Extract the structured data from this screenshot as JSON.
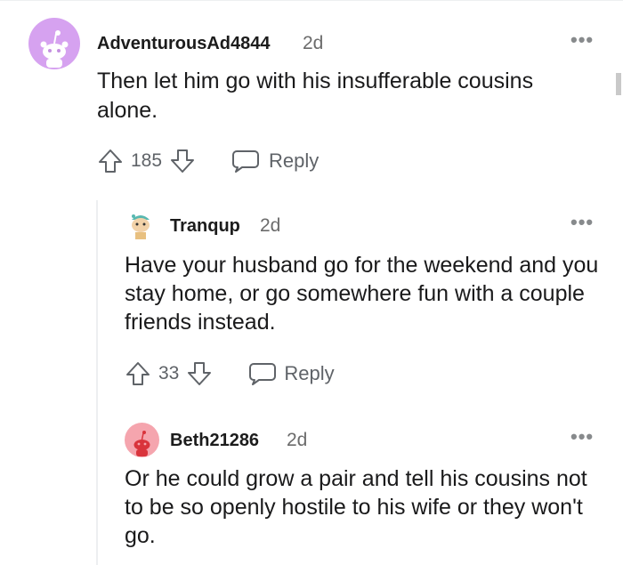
{
  "comments": [
    {
      "username": "AdventurousAd4844",
      "time": "2d",
      "body": "Then let him go with his insufferable cousins alone.",
      "votes": "185",
      "reply_label": "Reply",
      "more_icon": "more-dots-icon"
    },
    {
      "username": "Tranqup",
      "time": "2d",
      "body": "Have your husband go for the weekend and you stay home, or go somewhere fun with a couple friends instead.",
      "votes": "33",
      "reply_label": "Reply",
      "more_icon": "more-dots-icon"
    },
    {
      "username": "Beth21286",
      "time": "2d",
      "body": "Or he could grow a pair and tell his cousins not to be so openly hostile to his wife or they won't go.",
      "more_icon": "more-dots-icon"
    }
  ],
  "colors": {
    "avatar1_bg": "#d6a2f0",
    "avatar2_bg": "#ffffff",
    "avatar3_bg": "#f5a5ae",
    "icon_gray": "#5f6368"
  }
}
